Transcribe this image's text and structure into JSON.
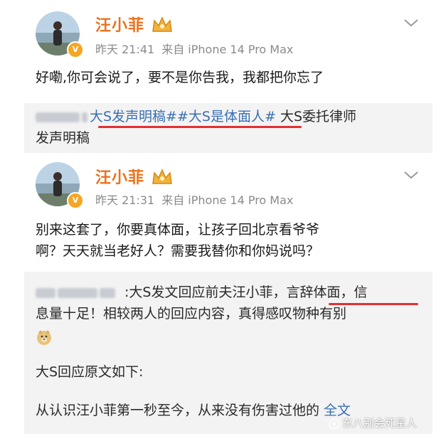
{
  "posts": [
    {
      "username": "汪小菲",
      "time": "昨天 21:41",
      "source": "来自 iPhone 14 Pro Max",
      "text": "好嘞,你可会说了，要不是你告我，我都把你忘了",
      "repost": {
        "tag1": "大S发声明稿#",
        "tag2": "#大S是体面人#",
        "tail1": "大S委托律师",
        "line2": "发声明稿"
      }
    },
    {
      "username": "汪小菲",
      "time": "昨天 21:31",
      "source": "来自 iPhone 14 Pro Max",
      "text_line1": "别来这套了，你要真体面，让孩子回北京看爷爷",
      "text_line2": "啊？天天就当老好人？需要我替你和你妈说吗？",
      "repost": {
        "line1": ":大S发文回应前夫汪小菲，言辞体面，信",
        "line2": "息量十足！相较两人的回应内容，真得感叹物种有别",
        "para2": "大S回应原文如下:",
        "para3": "从认识汪小菲第一秒至今，从来没有伤害过他的",
        "more": "全文"
      }
    }
  ],
  "watermark": "东八别会死星人",
  "icons": {
    "verified": "verified-badge-icon",
    "crown": "crown-icon",
    "chevron": "chevron-down-icon"
  },
  "colors": {
    "username": "#e8731c",
    "hashtag": "#3a6fb3",
    "underline": "#e23030",
    "meta": "#8a8a8a",
    "repost_bg": "#f3f3f3"
  }
}
